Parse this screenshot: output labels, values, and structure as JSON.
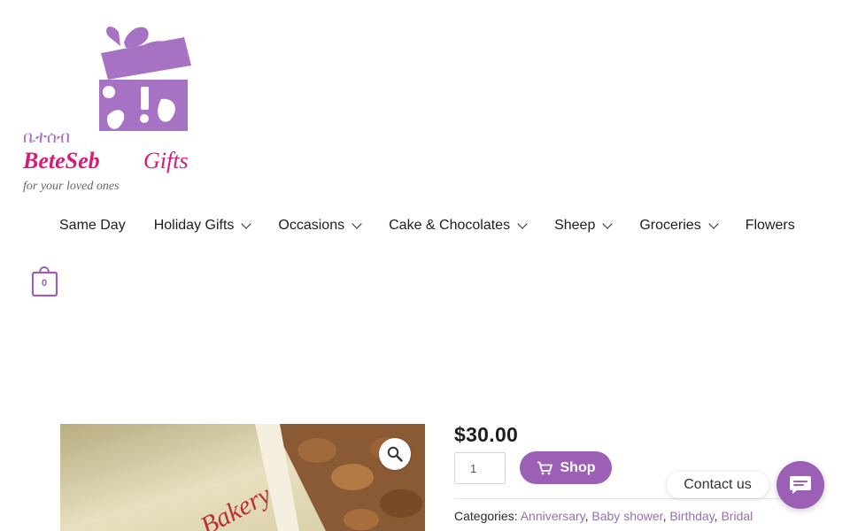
{
  "logo": {
    "script_text": "ቤተሰብ",
    "brand_text": "BeteSeb",
    "gifts_text": "Gifts",
    "tagline": "for your loved ones"
  },
  "nav": {
    "items": [
      {
        "label": "Same Day",
        "has_dropdown": false
      },
      {
        "label": "Holiday Gifts",
        "has_dropdown": true
      },
      {
        "label": "Occasions",
        "has_dropdown": true
      },
      {
        "label": "Cake & Chocolates",
        "has_dropdown": true
      },
      {
        "label": "Sheep",
        "has_dropdown": true
      },
      {
        "label": "Groceries",
        "has_dropdown": true
      },
      {
        "label": "Flowers",
        "has_dropdown": false
      }
    ]
  },
  "cart": {
    "count": "0",
    "icon": "shopping-bag-icon"
  },
  "product": {
    "image_text": "Bakery",
    "price": "$30.00",
    "quantity": "1",
    "shop_label": "Shop",
    "categories_label": "Categories:",
    "categories": [
      "Anniversary",
      "Baby shower",
      "Birthday",
      "Bridal"
    ]
  },
  "contact": {
    "label": "Contact us",
    "icon": "chat-icon"
  },
  "colors": {
    "accent": "#9b5fb5",
    "brand_pink": "#d81b7a",
    "link": "#9b6fb0"
  }
}
